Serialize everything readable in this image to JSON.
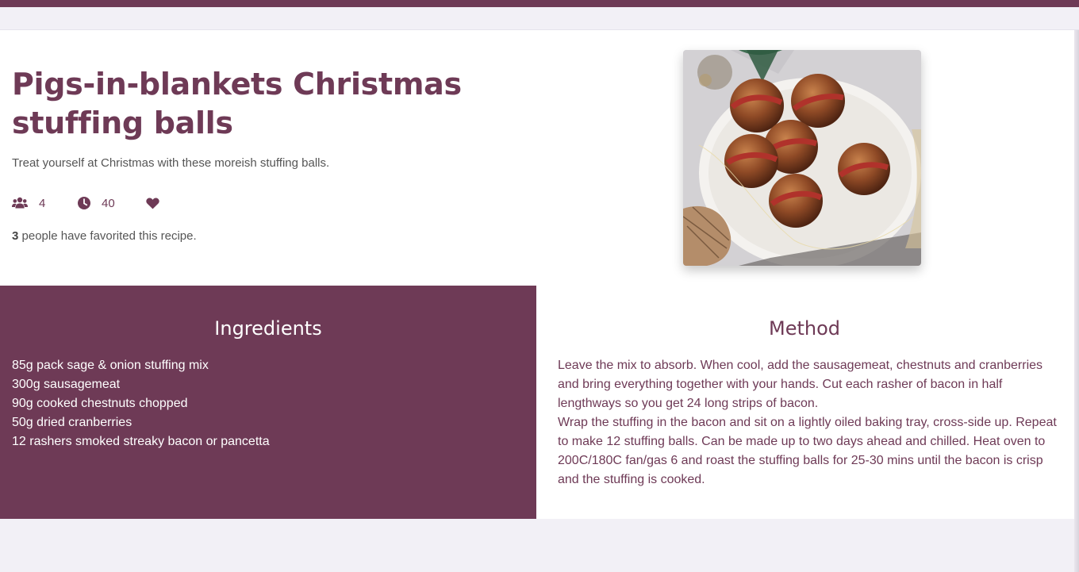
{
  "recipe": {
    "title": "Pigs-in-blankets Christmas stuffing balls",
    "description": "Treat yourself at Christmas with these moreish stuffing balls.",
    "servings": "4",
    "time": "40",
    "favorites_count": "3",
    "favorites_text": " people have favorited this recipe.",
    "image_alt": "Pigs-in-blankets Christmas stuffing balls"
  },
  "ingredients": {
    "heading": "Ingredients",
    "items": [
      "85g pack sage & onion stuffing mix",
      "300g sausagemeat",
      "90g cooked chestnuts chopped",
      "50g dried cranberries",
      "12 rashers smoked streaky bacon or pancetta"
    ]
  },
  "method": {
    "heading": "Method",
    "steps": [
      "Leave the mix to absorb. When cool, add the sausagemeat, chestnuts and cranberries and bring everything together with your hands. Cut each rasher of bacon in half lengthways so you get 24 long strips of bacon.",
      "Wrap the stuffing in the bacon and sit on a lightly oiled baking tray, cross-side up. Repeat to make 12 stuffing balls. Can be made up to two days ahead and chilled. Heat oven to 200C/180C fan/gas 6 and roast the stuffing balls for 25-30 mins until the bacon is crisp and the stuffing is cooked."
    ]
  },
  "icons": {
    "servings": "users-icon",
    "time": "clock-icon",
    "favorite": "heart-icon"
  },
  "colors": {
    "brand": "#6e3a56",
    "page_background": "#f2f0f6",
    "text_muted": "#555555"
  }
}
